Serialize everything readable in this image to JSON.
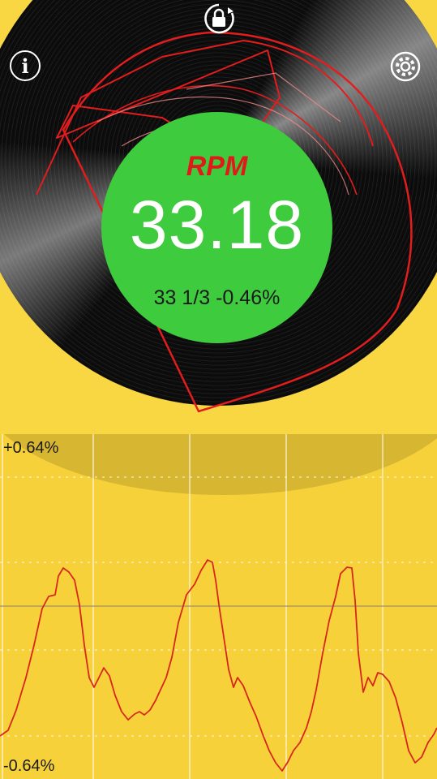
{
  "meter": {
    "title": "RPM",
    "value": "33.18",
    "sub": "33 1/3 -0.46%"
  },
  "controls": {
    "info_glyph": "i",
    "info_icon": "info-icon",
    "settings_icon": "gear-icon",
    "lock_icon": "lock-rotate-icon"
  },
  "graph": {
    "max_label": "+0.64%",
    "min_label": "-0.64%"
  },
  "colors": {
    "background": "#f9d743",
    "meter_disc": "#3ecb3e",
    "rpm_label": "#e0191b",
    "trace": "#d9261c"
  }
}
